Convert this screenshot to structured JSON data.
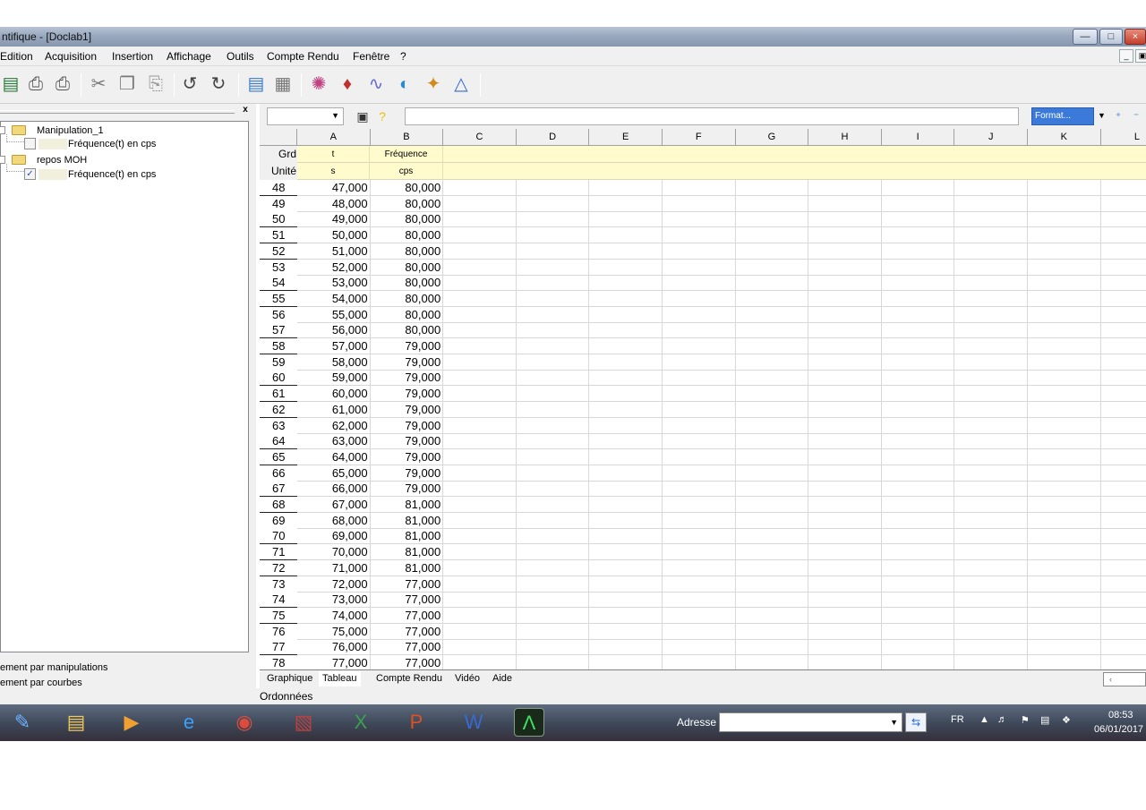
{
  "window": {
    "title": "ntifique - [Doclab1]"
  },
  "menu": [
    "Edition",
    "Acquisition",
    "Insertion",
    "Affichage",
    "Outils",
    "Compte Rendu",
    "Fenêtre",
    "?"
  ],
  "panel": {
    "close_label": "x",
    "tree": [
      {
        "type": "folder",
        "label": "Manipulation_1"
      },
      {
        "type": "curve",
        "label": "Fréquence(t) en cps",
        "checked": false
      },
      {
        "type": "folder",
        "label": "repos MOH"
      },
      {
        "type": "curve",
        "label": "Fréquence(t) en cps",
        "checked": true
      }
    ],
    "bottom_options": [
      "ement par manipulations",
      "ement par courbes"
    ]
  },
  "sheet": {
    "format_label": "Format...",
    "column_headers": [
      "A",
      "B",
      "C",
      "D",
      "E",
      "F",
      "G",
      "H",
      "I",
      "J",
      "K",
      "L"
    ],
    "grd_label": "Grd",
    "unit_label": "Unité",
    "grd_values": [
      "t",
      "Fréquence"
    ],
    "unit_values": [
      "s",
      "cps"
    ],
    "rows": [
      {
        "n": "48",
        "a": "47,000",
        "b": "80,000"
      },
      {
        "n": "49",
        "a": "48,000",
        "b": "80,000"
      },
      {
        "n": "50",
        "a": "49,000",
        "b": "80,000"
      },
      {
        "n": "51",
        "a": "50,000",
        "b": "80,000"
      },
      {
        "n": "52",
        "a": "51,000",
        "b": "80,000"
      },
      {
        "n": "53",
        "a": "52,000",
        "b": "80,000"
      },
      {
        "n": "54",
        "a": "53,000",
        "b": "80,000"
      },
      {
        "n": "55",
        "a": "54,000",
        "b": "80,000"
      },
      {
        "n": "56",
        "a": "55,000",
        "b": "80,000"
      },
      {
        "n": "57",
        "a": "56,000",
        "b": "80,000"
      },
      {
        "n": "58",
        "a": "57,000",
        "b": "79,000"
      },
      {
        "n": "59",
        "a": "58,000",
        "b": "79,000"
      },
      {
        "n": "60",
        "a": "59,000",
        "b": "79,000"
      },
      {
        "n": "61",
        "a": "60,000",
        "b": "79,000"
      },
      {
        "n": "62",
        "a": "61,000",
        "b": "79,000"
      },
      {
        "n": "63",
        "a": "62,000",
        "b": "79,000"
      },
      {
        "n": "64",
        "a": "63,000",
        "b": "79,000"
      },
      {
        "n": "65",
        "a": "64,000",
        "b": "79,000"
      },
      {
        "n": "66",
        "a": "65,000",
        "b": "79,000"
      },
      {
        "n": "67",
        "a": "66,000",
        "b": "79,000"
      },
      {
        "n": "68",
        "a": "67,000",
        "b": "81,000"
      },
      {
        "n": "69",
        "a": "68,000",
        "b": "81,000"
      },
      {
        "n": "70",
        "a": "69,000",
        "b": "81,000"
      },
      {
        "n": "71",
        "a": "70,000",
        "b": "81,000"
      },
      {
        "n": "72",
        "a": "71,000",
        "b": "81,000"
      },
      {
        "n": "73",
        "a": "72,000",
        "b": "77,000"
      },
      {
        "n": "74",
        "a": "73,000",
        "b": "77,000"
      },
      {
        "n": "75",
        "a": "74,000",
        "b": "77,000"
      },
      {
        "n": "76",
        "a": "75,000",
        "b": "77,000"
      },
      {
        "n": "77",
        "a": "76,000",
        "b": "77,000"
      },
      {
        "n": "78",
        "a": "77,000",
        "b": "77,000"
      }
    ],
    "tabs": [
      "Graphique",
      "Tableau",
      "Compte Rendu",
      "Vidéo",
      "Aide"
    ],
    "active_tab": "Tableau",
    "status": "Ordonnées"
  },
  "taskbar": {
    "address_label": "Adresse",
    "language": "FR",
    "time": "08:53",
    "date": "06/01/2017"
  },
  "colors": {
    "grid_yellow": "#fffbcc",
    "format_blue": "#3b7ad8",
    "taskbar_dark": "#3f4a5b"
  }
}
